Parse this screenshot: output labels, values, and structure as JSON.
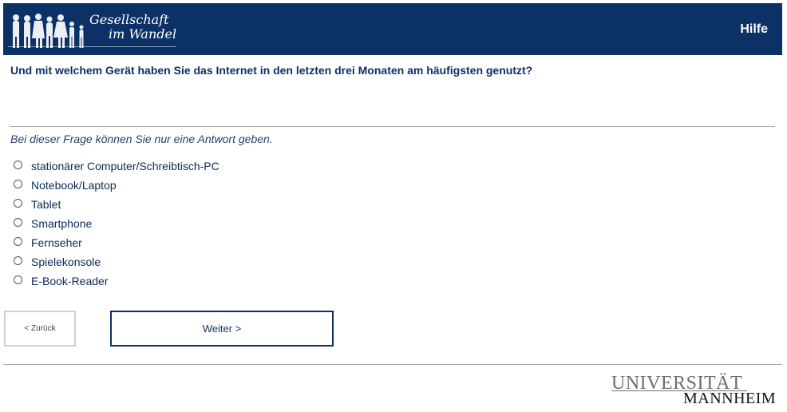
{
  "header": {
    "logo_line1": "Gesellschaft",
    "logo_line2": "im Wandel",
    "help_label": "Hilfe",
    "logo_icon": "people-silhouettes-icon"
  },
  "question": {
    "text": "Und mit welchem Gerät haben Sie das Internet in den letzten drei Monaten am häufigsten genutzt?",
    "instruction": "Bei dieser Frage können Sie nur eine Antwort geben.",
    "options": [
      {
        "label": "stationärer Computer/Schreibtisch-PC",
        "selected": false
      },
      {
        "label": "Notebook/Laptop",
        "selected": false
      },
      {
        "label": "Tablet",
        "selected": false
      },
      {
        "label": "Smartphone",
        "selected": false
      },
      {
        "label": "Fernseher",
        "selected": false
      },
      {
        "label": "Spielekonsole",
        "selected": false
      },
      {
        "label": "E-Book-Reader",
        "selected": false
      }
    ]
  },
  "navigation": {
    "back_label": "< Zurück",
    "next_label": "Weiter >"
  },
  "footer": {
    "university_line1": "UNIVERSITÄT",
    "university_line2": "MANNHEIM"
  },
  "colors": {
    "header_bg": "#0b3166",
    "text_primary": "#0b3166"
  }
}
